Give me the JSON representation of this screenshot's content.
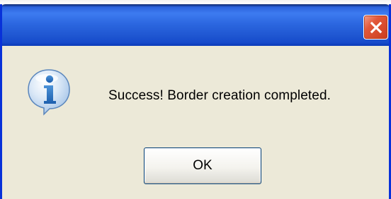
{
  "dialog": {
    "title": "",
    "message": "Success! Border creation completed.",
    "ok_label": "OK",
    "icon": "information-icon",
    "close_icon": "close-icon"
  },
  "colors": {
    "titlebar_blue": "#2b66df",
    "dialog_face": "#ece9d8",
    "close_red": "#e2583a",
    "icon_blue": "#3f82c8"
  }
}
